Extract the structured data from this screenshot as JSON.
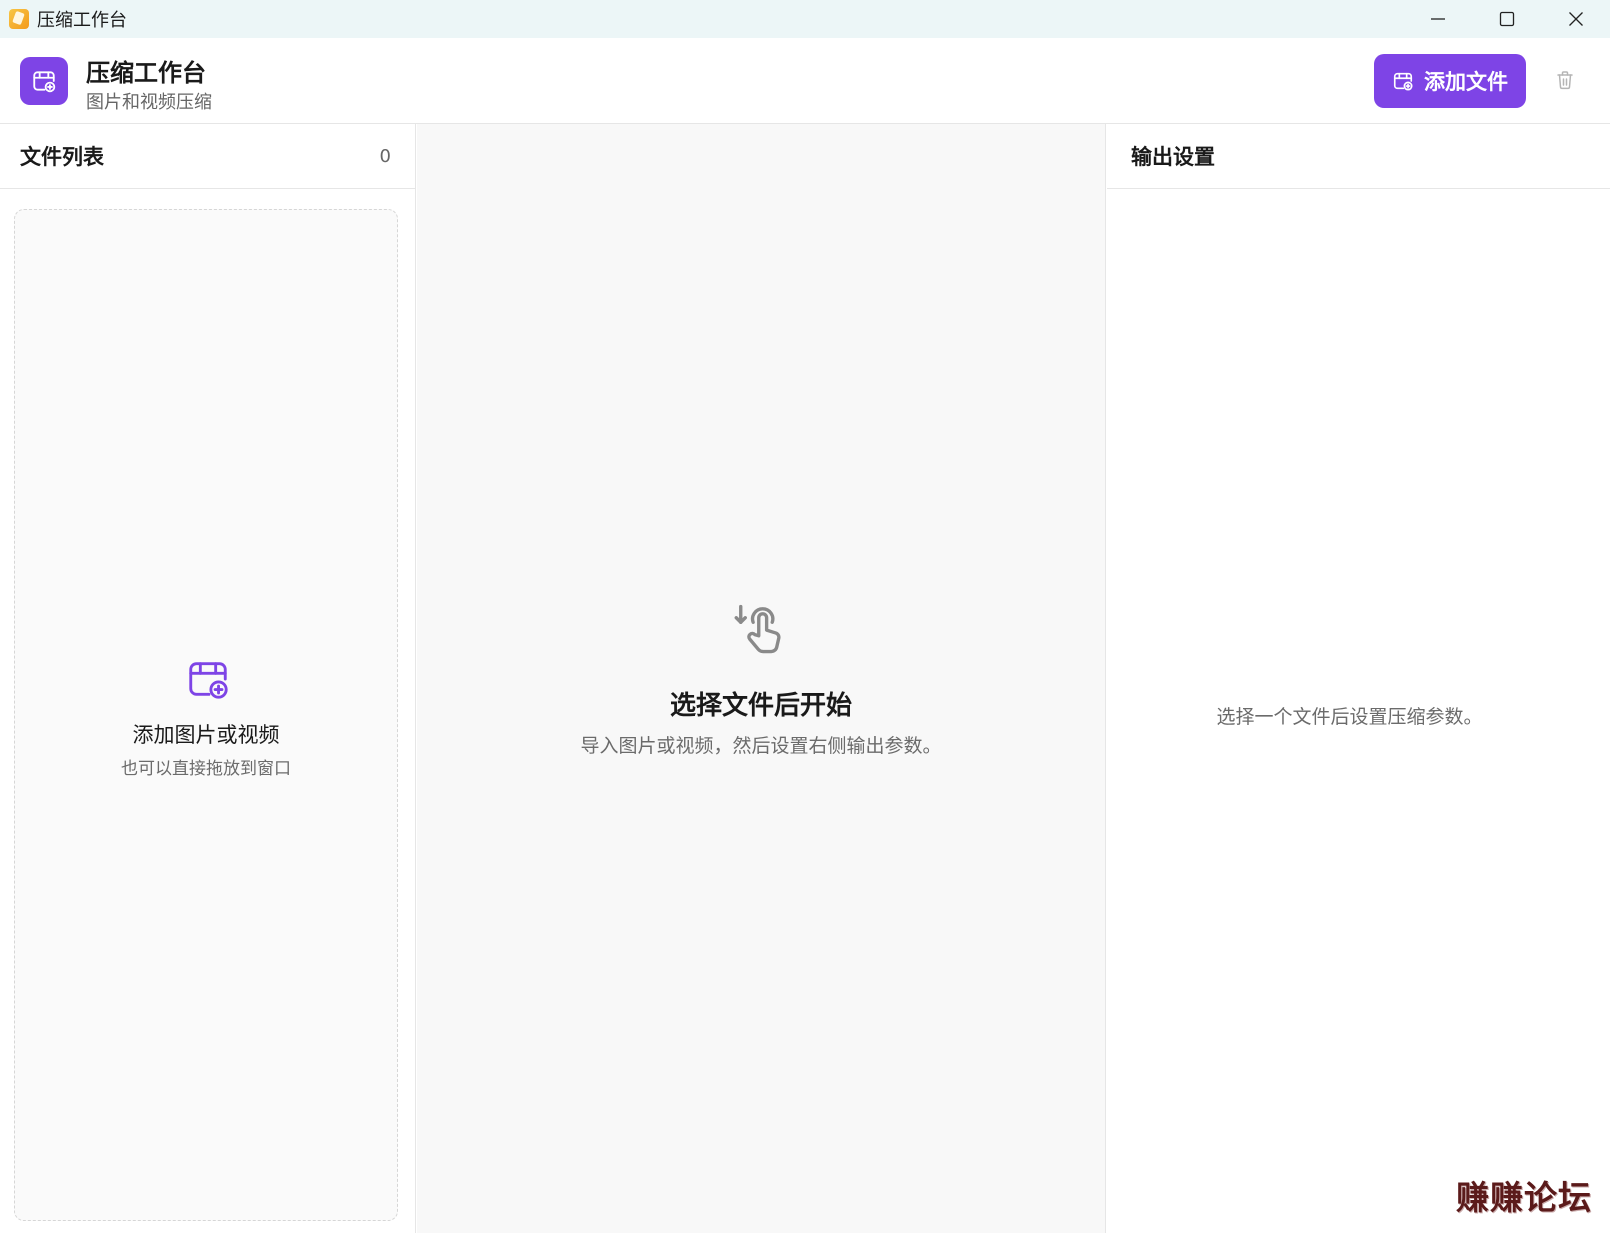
{
  "window": {
    "title": "压缩工作台",
    "app_icon": "app-icon",
    "controls": [
      "minimize-icon",
      "maximize-icon",
      "close-icon"
    ]
  },
  "header": {
    "title": "压缩工作台",
    "subtitle": "图片和视频压缩",
    "add_button_label": "添加文件",
    "accent_color": "#7e44e6"
  },
  "file_list": {
    "title": "文件列表",
    "count": "0",
    "dropzone": {
      "title": "添加图片或视频",
      "hint": "也可以直接拖放到窗口",
      "icon": "add-media-icon"
    }
  },
  "main": {
    "icon": "tap-select-icon",
    "title": "选择文件后开始",
    "subtitle": "导入图片或视频，然后设置右侧输出参数。"
  },
  "output_settings": {
    "title": "输出设置",
    "empty_text": "选择一个文件后设置压缩参数。"
  },
  "watermark": "赚赚论坛"
}
